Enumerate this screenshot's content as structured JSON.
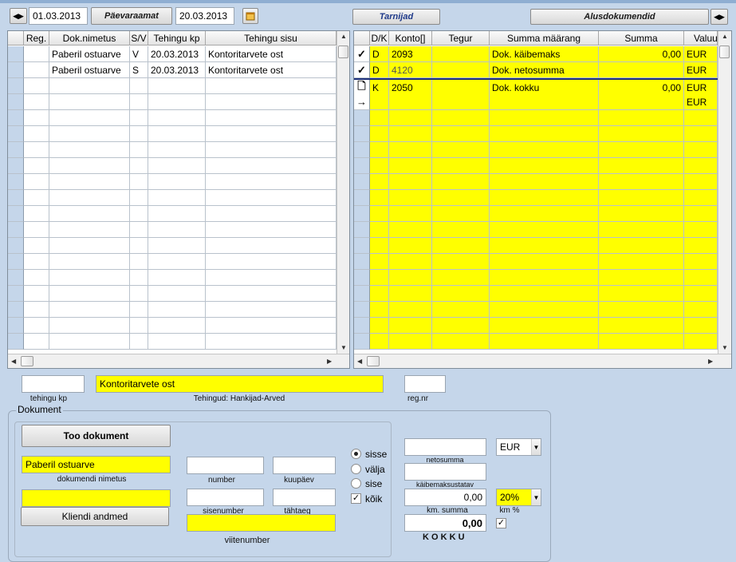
{
  "toolbar": {
    "date_from": "01.03.2013",
    "paevaraamat_label": "Päevaraamat",
    "date_to": "20.03.2013",
    "tarnijad_label": "Tarnijad",
    "alusdokumendid_label": "Alusdokumendid"
  },
  "left_grid": {
    "columns": [
      "Reg.",
      "Dok.nimetus",
      "S/V",
      "Tehingu kp",
      "Tehingu sisu"
    ],
    "rows": [
      [
        "",
        "Paberil ostuarve",
        "V",
        "20.03.2013",
        "Kontoritarvete ost"
      ],
      [
        "",
        "Paberil ostuarve",
        "S",
        "20.03.2013",
        "Kontoritarvete ost"
      ]
    ]
  },
  "right_grid": {
    "columns": [
      "D/K",
      "Konto[]",
      "Tegur",
      "Summa määrang",
      "Summa",
      "Valuu"
    ],
    "rows": [
      {
        "marker": "check",
        "dk": "D",
        "konto": "2093",
        "tegur": "",
        "maarang": "Dok. käibemaks",
        "summa": "0,00",
        "valuuta": "EUR"
      },
      {
        "marker": "check",
        "dk": "D",
        "konto": "4120",
        "tegur": "",
        "maarang": "Dok. netosumma",
        "summa": "",
        "valuuta": "EUR"
      },
      {
        "marker": "doc",
        "dk": "K",
        "konto": "2050",
        "tegur": "",
        "maarang": "Dok. kokku",
        "summa": "0,00",
        "valuuta": "EUR"
      },
      {
        "marker": "arrow",
        "dk": "",
        "konto": "",
        "tegur": "",
        "maarang": "",
        "summa": "",
        "valuuta": "EUR"
      }
    ]
  },
  "details": {
    "tehingu_kp_value": "",
    "tehingu_kp_label": "tehingu kp",
    "sisu_value": "Kontoritarvete ost",
    "tehingud_label": "Tehingud: Hankijad-Arved",
    "reg_nr_value": "",
    "reg_nr_label": "reg.nr"
  },
  "dokument": {
    "group_label": "Dokument",
    "too_dokument_label": "Too dokument",
    "nimetus_value": "Paberil ostuarve",
    "nimetus_label": "dokumendi nimetus",
    "number_label": "number",
    "kuupaev_label": "kuupäev",
    "kliendi_value": "",
    "kliendi_andmed_label": "Kliendi andmed",
    "sisenumber_label": "sisenumber",
    "tahtaeg_label": "tähtaeg",
    "viitenumber_label": "viitenumber",
    "radio_sisse": "sisse",
    "radio_valja": "välja",
    "radio_sise": "sise",
    "check_koik": "kõik",
    "netosumma_label": "netosumma",
    "kaibemaksustatav_label": "käibemaksustatav",
    "km_summa_value": "0,00",
    "km_summa_label": "km. summa",
    "kokku_value": "0,00",
    "kokku_label": "K O K K U",
    "currency": "EUR",
    "km_percent": "20%",
    "km_percent_label": "km %"
  }
}
